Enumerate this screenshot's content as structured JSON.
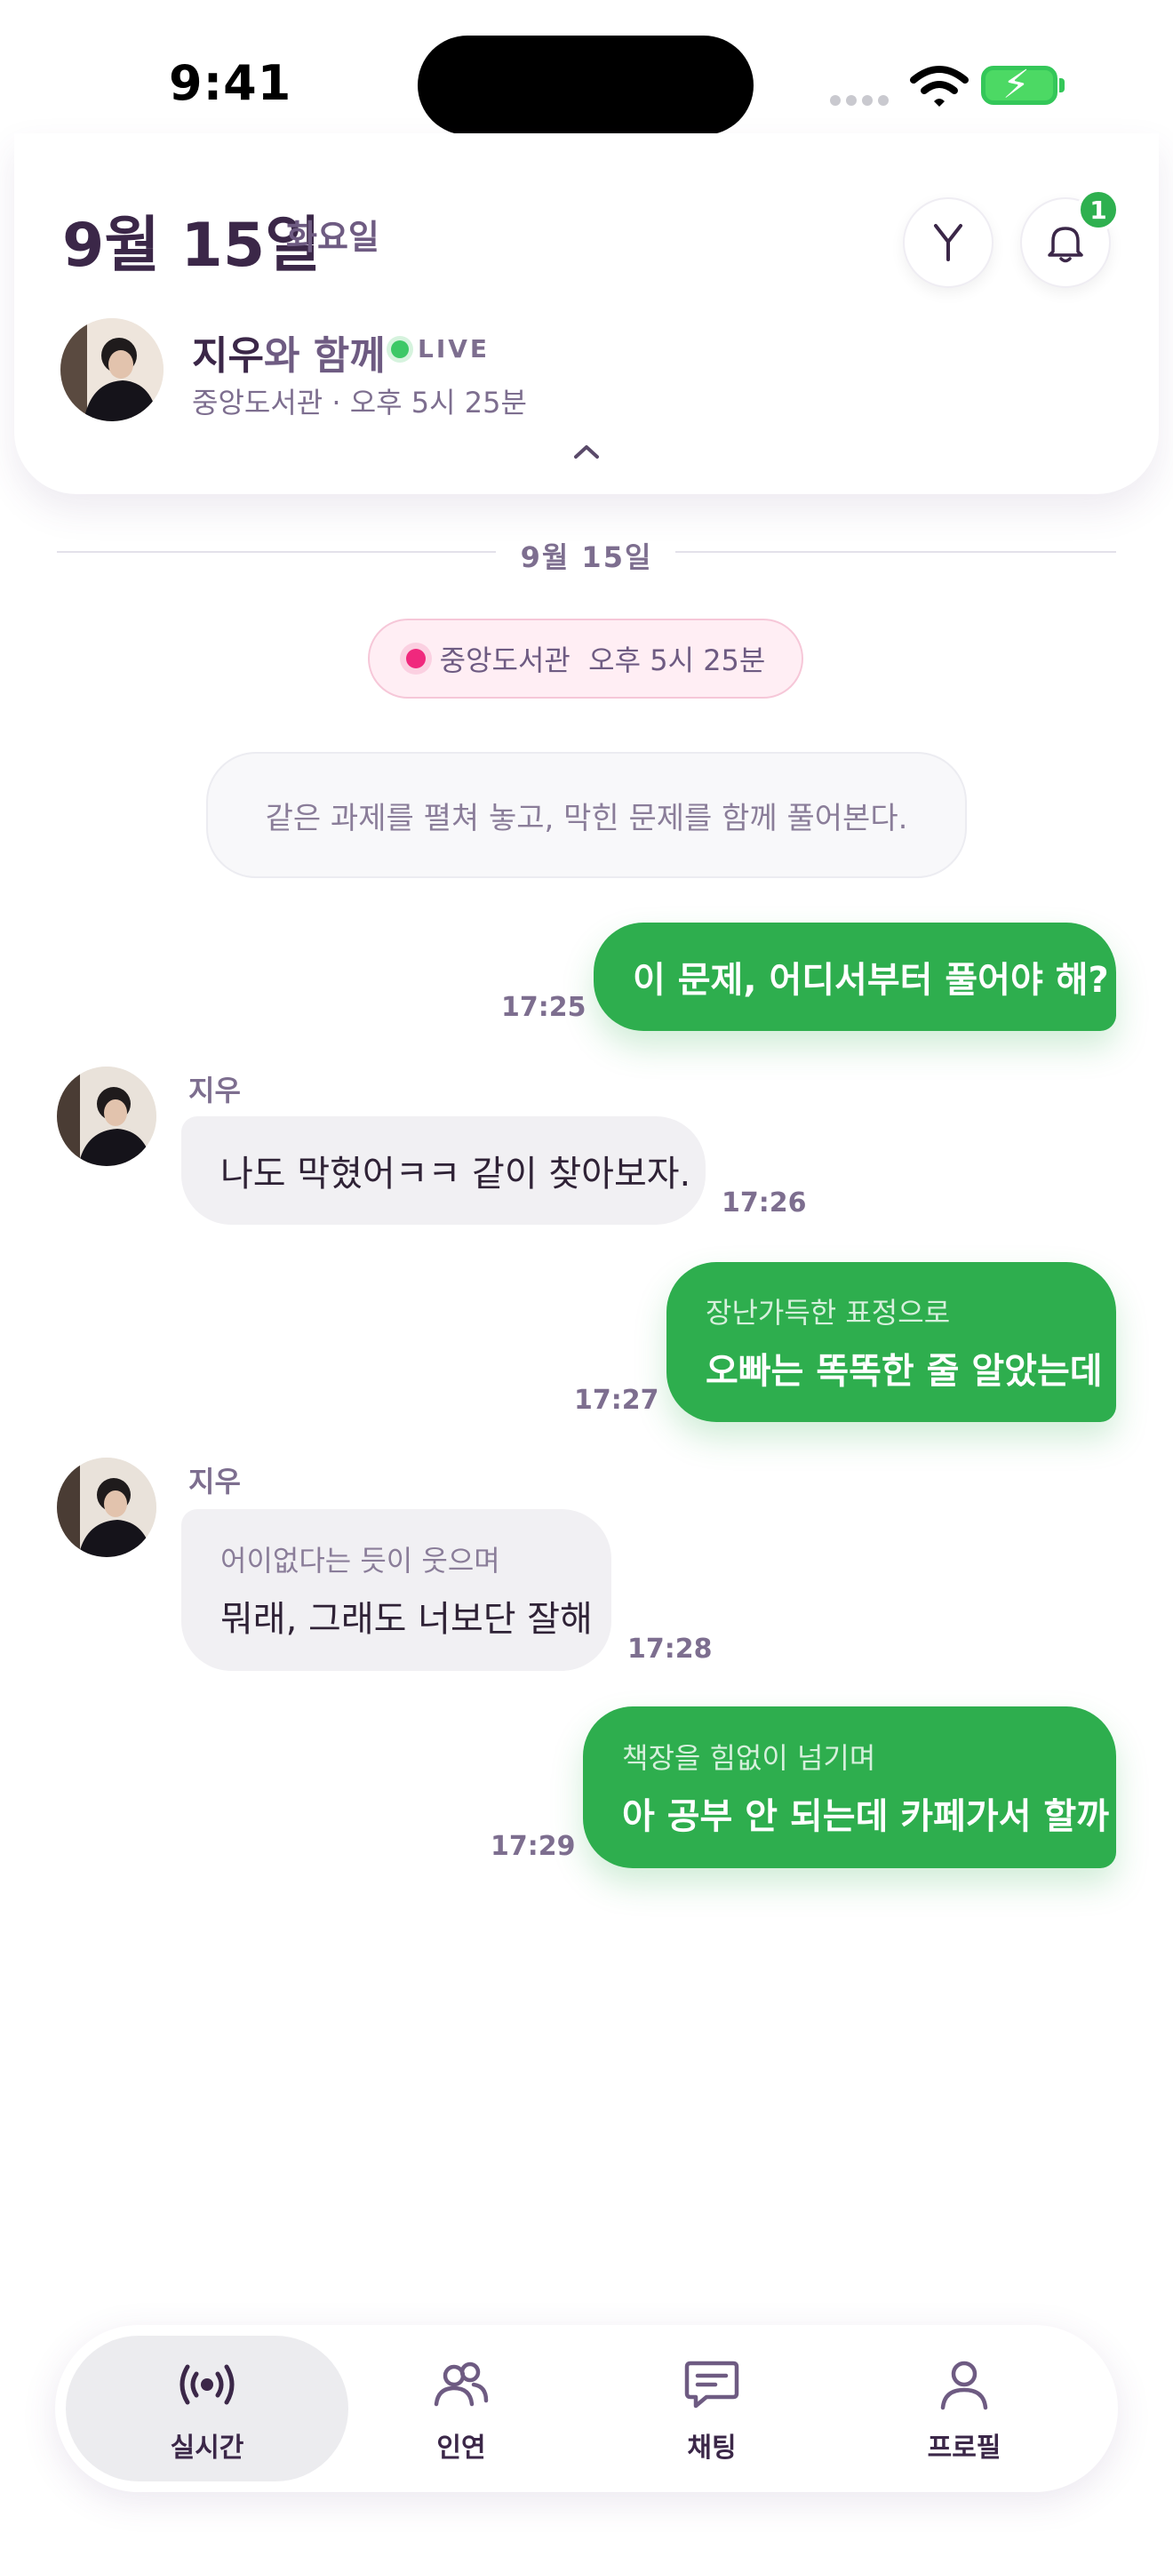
{
  "status_bar": {
    "time": "9:41"
  },
  "header": {
    "date": "9월 15일",
    "weekday": "화요일",
    "notification_count": "1",
    "partner_name": "지우",
    "partner_suffix": "와 함께",
    "live_label": "LIVE",
    "location_time": "중앙도서관 · 오후 5시 25분"
  },
  "divider_date": "9월 15일",
  "location_pill": "중앙도서관  오후 5시 25분",
  "narration": "같은 과제를 펼쳐 놓고, 막힌 문제를 함께 풀어본다.",
  "messages": [
    {
      "from": "me",
      "text": "이 문제, 어디서부터 풀어야 해?",
      "time": "17:25"
    },
    {
      "from": "지우",
      "text": "나도 막혔어ㅋㅋ 같이 찾아보자.",
      "time": "17:26"
    },
    {
      "from": "me",
      "action": "장난가득한 표정으로",
      "text": "오빠는 똑똑한 줄 알았는데",
      "time": "17:27"
    },
    {
      "from": "지우",
      "action": "어이없다는 듯이 웃으며",
      "text": "뭐래, 그래도 너보단 잘해",
      "time": "17:28"
    },
    {
      "from": "me",
      "action": "책장을 힘없이 넘기며",
      "text": "아 공부 안 되는데 카페가서 할까",
      "time": "17:29"
    }
  ],
  "tabs": [
    {
      "label": "실시간",
      "icon": "broadcast-icon",
      "active": true
    },
    {
      "label": "인연",
      "icon": "people-icon",
      "active": false
    },
    {
      "label": "채팅",
      "icon": "chat-icon",
      "active": false
    },
    {
      "label": "프로필",
      "icon": "profile-icon",
      "active": false
    }
  ]
}
